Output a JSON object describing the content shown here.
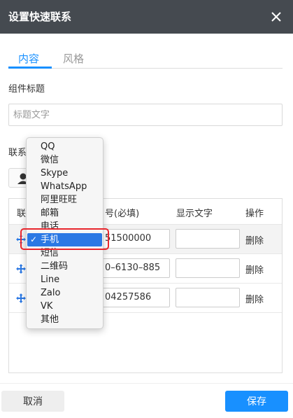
{
  "dialog": {
    "title": "设置快速联系"
  },
  "tabs": [
    {
      "label": "内容"
    },
    {
      "label": "风格"
    }
  ],
  "component_title": {
    "label": "组件标题",
    "placeholder": "标题文字"
  },
  "contact_section": {
    "label": "联系"
  },
  "table": {
    "headers": {
      "type": "联",
      "number": "号(必填)",
      "display": "显示文字",
      "action": "操作"
    },
    "rows": [
      {
        "number": "51500000",
        "display": "",
        "delete": "删除"
      },
      {
        "number": "0–6130–885",
        "display": "",
        "delete": "删除"
      },
      {
        "number": "04257586",
        "display": "",
        "delete": "删除"
      }
    ]
  },
  "dropdown": {
    "options": [
      "QQ",
      "微信",
      "Skype",
      "WhatsApp",
      "阿里旺旺",
      "邮箱",
      "电话",
      "手机",
      "短信",
      "二维码",
      "Line",
      "Zalo",
      "VK",
      "其他"
    ],
    "selected": "手机",
    "check": "✓"
  },
  "footer": {
    "cancel_label": "取消",
    "save_label": "保存"
  },
  "colors": {
    "accent": "#1890ff",
    "titlebar": "#454a50",
    "highlight": "#e8262d",
    "selected_option": "#2b78e4"
  }
}
